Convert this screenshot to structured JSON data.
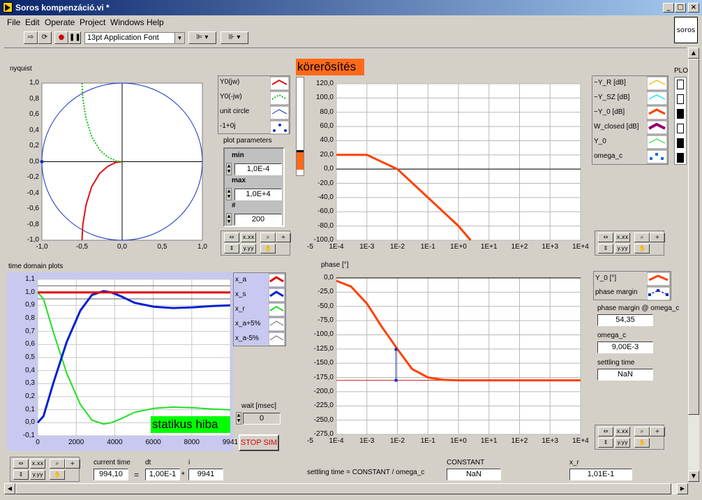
{
  "window": {
    "title": "Soros kompenzáció.vi *",
    "min": "_",
    "max": "□",
    "close": "×"
  },
  "menu": [
    "File",
    "Edit",
    "Operate",
    "Project",
    "Windows",
    "Help"
  ],
  "toolbar": {
    "font": "13pt Application Font"
  },
  "vi_icon": "soros",
  "nyquist": {
    "label": "nyquist",
    "xticks": [
      "-1,0",
      "-0,5",
      "0,0",
      "0,5",
      "1,0"
    ],
    "yticks": [
      "1,0",
      "0,8",
      "0,6",
      "0,4",
      "0,2",
      "0,0",
      "-0,2",
      "-0,4",
      "-0,6",
      "-0,8",
      "-1,0"
    ],
    "legend": [
      "Y0(jw)",
      "Y0(-jw)",
      "unit circle",
      "-1+0j"
    ]
  },
  "plot_params": {
    "label": "plot parameters",
    "min_label": "min",
    "min": "1,0E-4",
    "max_label": "max",
    "max": "1,0E+4",
    "n_label": "#",
    "n": "200"
  },
  "gain": {
    "label": "körerõsítés",
    "xticks": [
      "1E-4",
      "1E-3",
      "1E-2",
      "1E-1",
      "1E+0",
      "1E+1",
      "1E+2",
      "1E+3",
      "1E+4"
    ],
    "xfirst": "-5",
    "yticks": [
      "120,0",
      "100,0",
      "80,0",
      "60,0",
      "40,0",
      "20,0",
      "0,0",
      "-20,0",
      "-40,0",
      "-60,0",
      "-80,0",
      "-100,0"
    ],
    "legend": [
      "~Y_R [dB]",
      "~Y_SZ [dB]",
      "~Y_0 [dB]",
      "W_closed [dB]",
      "Y_0",
      "omega_c"
    ],
    "plo_label": "PLO"
  },
  "time": {
    "label": "time domain plots",
    "xticks": [
      "0",
      "2000",
      "4000",
      "6000",
      "8000",
      "9941"
    ],
    "yticks": [
      "1,1",
      "1,0",
      "0,9",
      "0,8",
      "0,7",
      "0,6",
      "0,5",
      "0,4",
      "0,3",
      "0,2",
      "0,1",
      "0,0",
      "-0,1"
    ],
    "legend": [
      "x_a",
      "x_s",
      "x_r",
      "x_a+5%",
      "x_a-5%"
    ],
    "badge": "statikus hiba"
  },
  "wait": {
    "label": "wait [msec]",
    "value": "0"
  },
  "stop": "STOP SIM",
  "phase": {
    "label": "phase [°]",
    "xfirst": "-5",
    "xticks": [
      "1E-4",
      "1E-3",
      "1E-2",
      "1E-1",
      "1E+0",
      "1E+1",
      "1E+2",
      "1E+3",
      "1E+4"
    ],
    "yticks": [
      "0,0",
      "-25,0",
      "-50,0",
      "-75,0",
      "-100,0",
      "-125,0",
      "-150,0",
      "-175,0",
      "-200,0",
      "-225,0",
      "-250,0",
      "-275,0"
    ],
    "legend": [
      "Y_0 [°]",
      "phase margin"
    ]
  },
  "indicators": {
    "pm_label": "phase margin @ omega_c",
    "pm": "54,35",
    "wc_label": "omega_c",
    "wc": "9,00E-3",
    "st_label": "settling time",
    "st": "NaN"
  },
  "bottom": {
    "ct_label": "current time",
    "ct": "994,10",
    "eq": "=",
    "dt_label": "dt",
    "dt": "1,00E-1",
    "mul": "*",
    "i_label": "i",
    "i": "9941",
    "formula": "settling time = CONSTANT / omega_c",
    "const_label": "CONSTANT",
    "const": "NaN",
    "xr_label": "x_r",
    "xr": "1,01E-1"
  },
  "palette_icons": [
    "x-scale-icon",
    "x-format-icon",
    "zoom-icon",
    "cursor-icon",
    "y-scale-icon",
    "y-format-icon",
    "hand-icon"
  ],
  "chart_data": [
    {
      "type": "line",
      "title": "nyquist",
      "xlim": [
        -1,
        1
      ],
      "ylim": [
        -1,
        1
      ],
      "grid": false,
      "series": [
        {
          "name": "Y0(jw)",
          "color": "#e01010",
          "x": [
            -0.5,
            -0.49,
            -0.45,
            -0.38,
            -0.28,
            -0.18,
            -0.08,
            0
          ],
          "y": [
            -1.0,
            -0.8,
            -0.55,
            -0.32,
            -0.15,
            -0.06,
            -0.01,
            0
          ]
        },
        {
          "name": "Y0(-jw)",
          "color": "#10c010",
          "x": [
            -0.5,
            -0.49,
            -0.45,
            -0.38,
            -0.28,
            -0.18,
            -0.08,
            0
          ],
          "y": [
            1.0,
            0.8,
            0.55,
            0.32,
            0.15,
            0.06,
            0.01,
            0
          ]
        },
        {
          "name": "unit circle",
          "color": "#1030c0"
        },
        {
          "name": "-1+0j",
          "color": "#1030c0",
          "x": [
            -1
          ],
          "y": [
            0
          ]
        }
      ]
    },
    {
      "type": "line",
      "title": "körerõsítés",
      "xscale": "log",
      "xlim": [
        0.0001,
        10000
      ],
      "ylim": [
        -100,
        120
      ],
      "grid": true,
      "series": [
        {
          "name": "~Y_0 [dB]",
          "color": "#ff4000",
          "x": [
            0.0001,
            0.001,
            0.01,
            0.1,
            1,
            2.5
          ],
          "y": [
            20,
            20,
            0,
            -40,
            -80,
            -100
          ]
        },
        {
          "name": "Y_0",
          "color": "#20c020",
          "x": [
            0.0001,
            0.001,
            0.01
          ],
          "y": [
            20,
            19,
            0
          ]
        }
      ]
    },
    {
      "type": "line",
      "title": "time domain plots",
      "xlim": [
        0,
        9941
      ],
      "ylim": [
        -0.1,
        1.1
      ],
      "grid": true,
      "series": [
        {
          "name": "x_a",
          "color": "#e00000",
          "x": [
            0,
            9941
          ],
          "y": [
            1,
            1
          ]
        },
        {
          "name": "x_s",
          "color": "#0020d0",
          "x": [
            0,
            300,
            800,
            1500,
            2200,
            2800,
            3400,
            3800,
            4300,
            5000,
            6000,
            7000,
            8000,
            9000,
            9941
          ],
          "y": [
            0,
            0.05,
            0.3,
            0.62,
            0.86,
            0.98,
            1.01,
            1.0,
            0.97,
            0.92,
            0.89,
            0.88,
            0.885,
            0.895,
            0.9
          ]
        },
        {
          "name": "x_r",
          "color": "#20e020",
          "x": [
            0,
            300,
            800,
            1500,
            2200,
            2800,
            3400,
            3800,
            4300,
            5000,
            6000,
            7000,
            8000,
            9000,
            9941
          ],
          "y": [
            1,
            0.95,
            0.7,
            0.38,
            0.14,
            0.02,
            -0.01,
            0,
            0.03,
            0.08,
            0.11,
            0.12,
            0.115,
            0.105,
            0.1
          ]
        },
        {
          "name": "x_a+5%",
          "color": "#606060",
          "x": [
            0,
            9941
          ],
          "y": [
            1.05,
            1.05
          ]
        },
        {
          "name": "x_a-5%",
          "color": "#606060",
          "x": [
            0,
            9941
          ],
          "y": [
            0.95,
            0.95
          ]
        }
      ]
    },
    {
      "type": "line",
      "title": "phase [°]",
      "xscale": "log",
      "xlim": [
        0.0001,
        10000
      ],
      "ylim": [
        -275,
        0
      ],
      "grid": true,
      "series": [
        {
          "name": "Y_0 [°]",
          "color": "#ff4000",
          "x": [
            0.0001,
            0.0003,
            0.001,
            0.003,
            0.01,
            0.03,
            0.1,
            0.3,
            1,
            10000
          ],
          "y": [
            -5,
            -15,
            -45,
            -85,
            -125,
            -160,
            -175,
            -179,
            -180,
            -180
          ]
        },
        {
          "name": "phase margin",
          "color": "#1030c0",
          "x": [
            0.009,
            0.009
          ],
          "y": [
            -125.65,
            -180
          ]
        }
      ]
    }
  ]
}
